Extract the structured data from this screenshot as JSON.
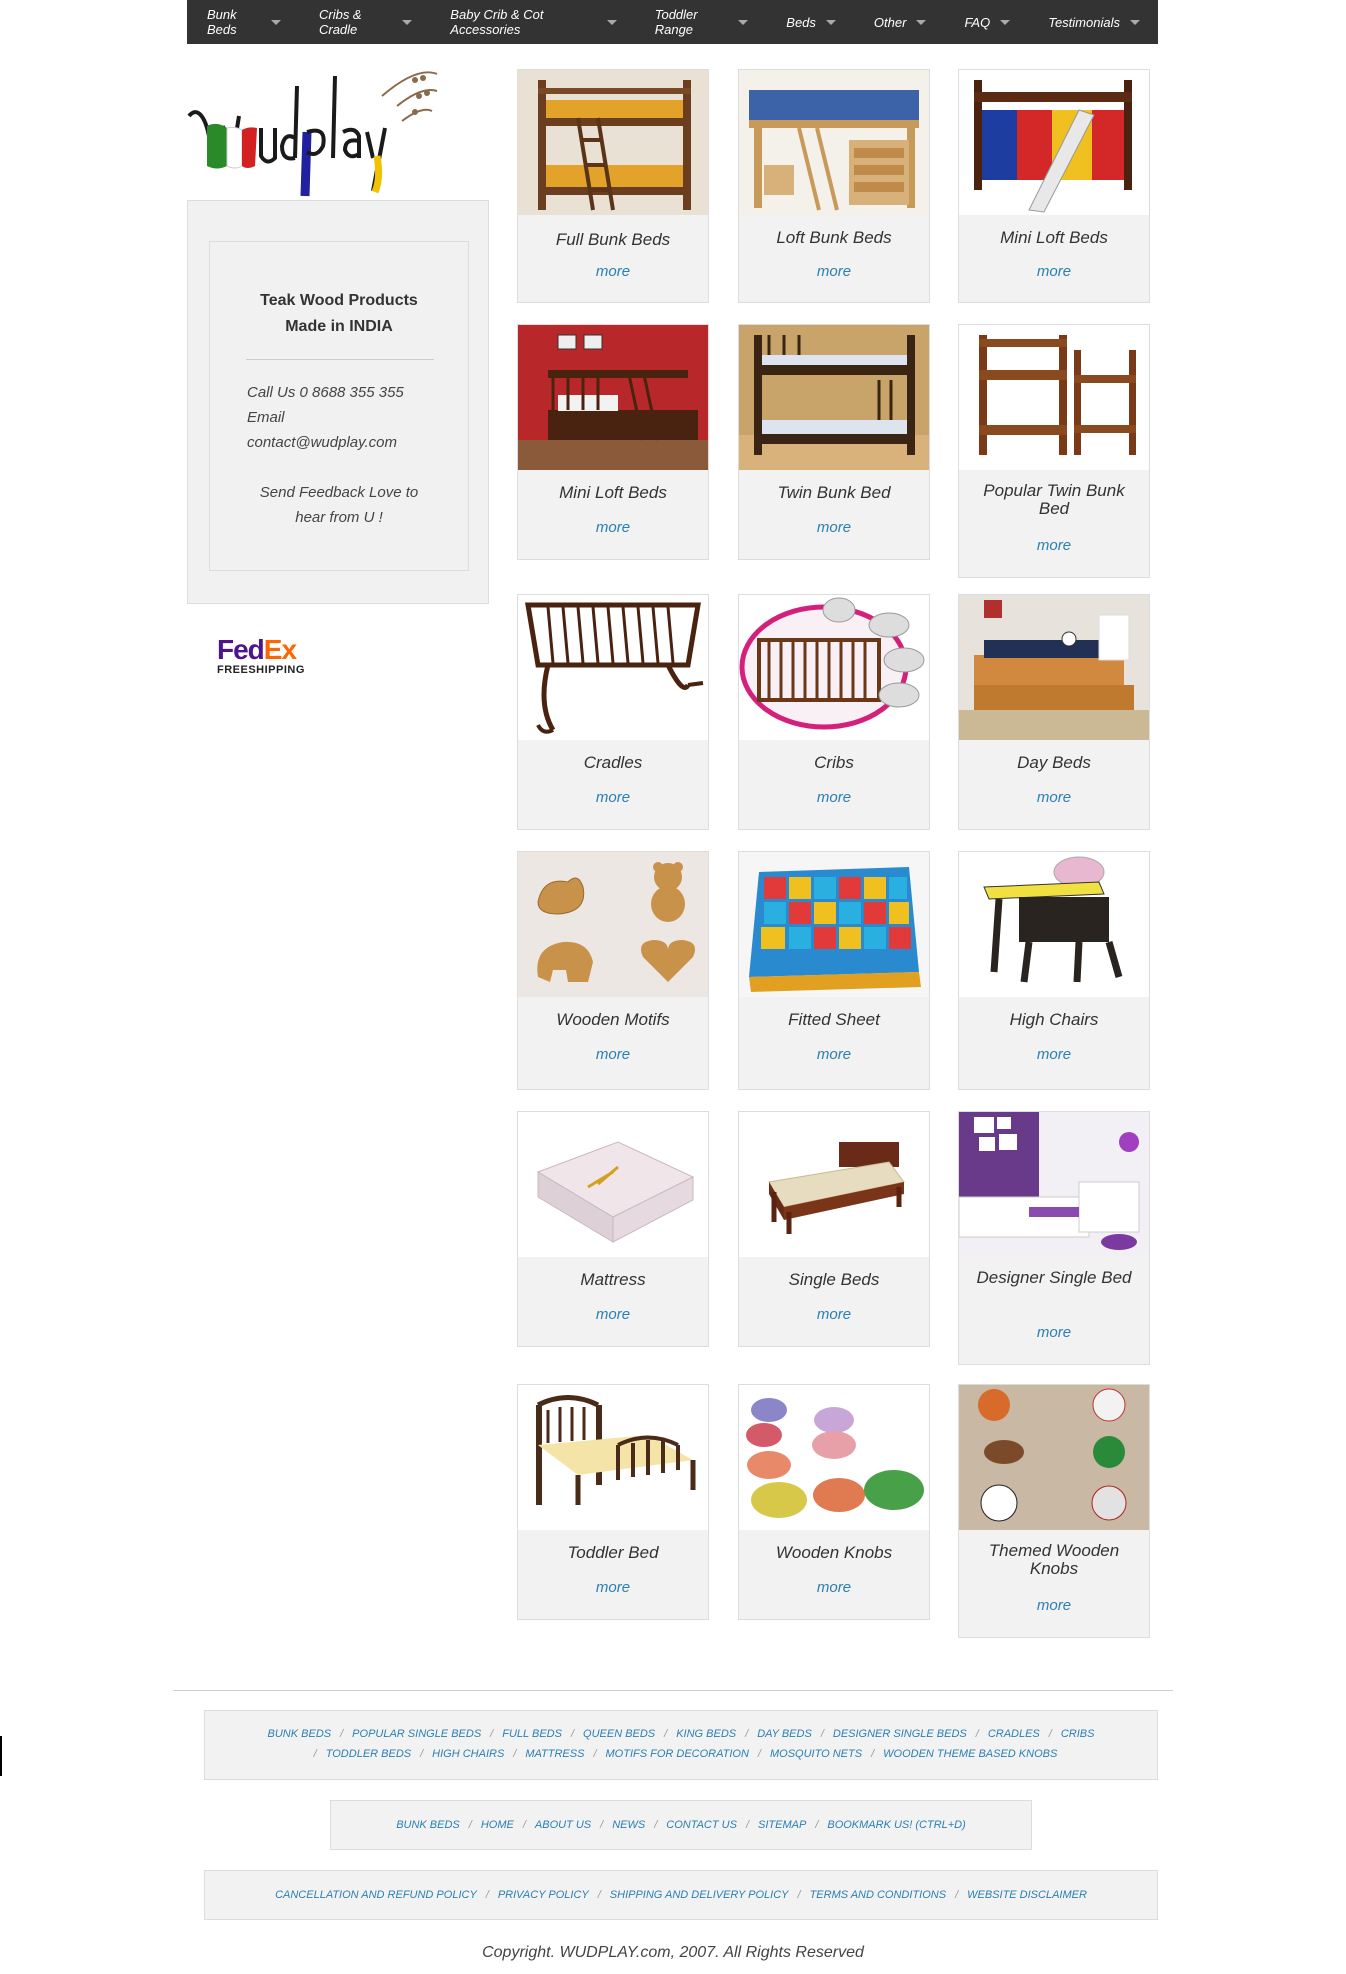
{
  "nav": [
    {
      "label": "Bunk Beds"
    },
    {
      "label": "Cribs & Cradle"
    },
    {
      "label": "Baby Crib & Cot Accessories"
    },
    {
      "label": "Toddler Range"
    },
    {
      "label": "Beds"
    },
    {
      "label": "Other"
    },
    {
      "label": "FAQ"
    },
    {
      "label": "Testimonials"
    }
  ],
  "logo": {
    "text": "Wudplay"
  },
  "sidebar": {
    "title_line1": "Teak Wood Products",
    "title_line2": "Made in INDIA",
    "call": "Call Us 0 8688 355 355",
    "email_label": "Email",
    "email": "contact@wudplay.com",
    "feedback_line1": "Send Feedback Love to",
    "feedback_line2": "hear from U !"
  },
  "fedex": {
    "brand_fed": "Fed",
    "brand_ex": "Ex",
    "tagline": "FREESHIPPING"
  },
  "products": [
    {
      "title": "Full Bunk Beds",
      "more": "more"
    },
    {
      "title": "Loft Bunk Beds",
      "more": "more"
    },
    {
      "title": "Mini Loft Beds",
      "more": "more"
    },
    {
      "title": "Mini Loft Beds",
      "more": "more"
    },
    {
      "title": "Twin Bunk Bed",
      "more": "more"
    },
    {
      "title": "Popular Twin Bunk Bed",
      "more": "more"
    },
    {
      "title": "Cradles",
      "more": "more"
    },
    {
      "title": "Cribs",
      "more": "more"
    },
    {
      "title": "Day Beds",
      "more": "more"
    },
    {
      "title": "Wooden Motifs",
      "more": "more"
    },
    {
      "title": "Fitted Sheet",
      "more": "more"
    },
    {
      "title": "High Chairs",
      "more": "more"
    },
    {
      "title": "Mattress",
      "more": "more"
    },
    {
      "title": "Single Beds",
      "more": "more"
    },
    {
      "title": "Designer Single Bed",
      "more": "more"
    },
    {
      "title": "Toddler Bed",
      "more": "more"
    },
    {
      "title": "Wooden Knobs",
      "more": "more"
    },
    {
      "title": "Themed Wooden Knobs",
      "more": "more"
    }
  ],
  "footer": {
    "categories_row1": [
      "Bunk Beds",
      "Popular Single Beds",
      "Full Beds",
      "Queen Beds",
      "King Beds",
      "Day Beds",
      "Designer Single Beds",
      "Cradles",
      "Cribs"
    ],
    "categories_row2": [
      "Toddler Beds",
      "High Chairs",
      "Mattress",
      "Motifs for Decoration",
      "Mosquito Nets",
      "Wooden Theme Based Knobs"
    ],
    "site_links": [
      "Bunk Beds",
      "Home",
      "About Us",
      "News",
      "Contact Us",
      "Sitemap",
      "Bookmark Us! (Ctrl+D)"
    ],
    "policy_links": [
      "Cancellation and Refund Policy",
      "Privacy Policy",
      "Shipping and Delivery Policy",
      "Terms and Conditions",
      "Website Disclaimer"
    ],
    "copyright": "Copyright. WUDPLAY.com, 2007. All Rights Reserved"
  }
}
